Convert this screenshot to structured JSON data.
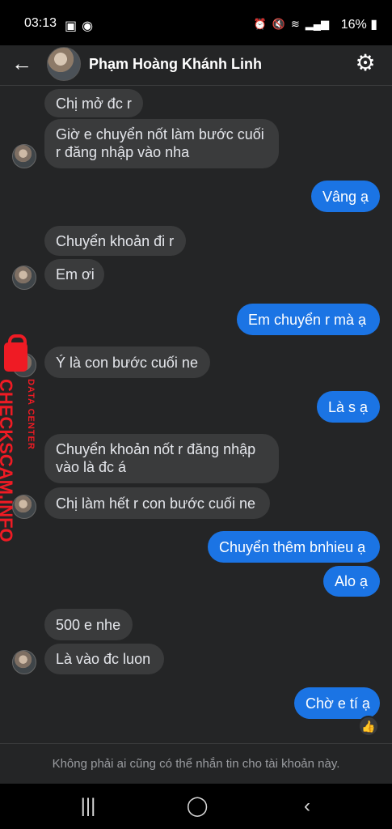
{
  "status_bar": {
    "time": "03:13",
    "battery": "16%",
    "left_icons": [
      "image-icon",
      "messenger-icon"
    ],
    "right_icons": [
      "alarm-icon",
      "mute-icon",
      "wifi-icon",
      "signal-icon",
      "battery-icon"
    ]
  },
  "header": {
    "contact_name": "Phạm Hoàng Khánh Linh",
    "back_icon": "arrow-left-icon",
    "settings_icon": "gear-icon"
  },
  "messages": [
    {
      "id": "m1",
      "direction": "in",
      "text": "Chị mở đc r"
    },
    {
      "id": "m2",
      "direction": "in",
      "text": "Giờ e chuyển nốt làm bước cuối r đăng nhập vào nha"
    },
    {
      "id": "m3",
      "direction": "out",
      "text": "Vâng ạ"
    },
    {
      "id": "m4",
      "direction": "in",
      "text": "Chuyển khoản đi r"
    },
    {
      "id": "m5",
      "direction": "in",
      "text": "Em ơi"
    },
    {
      "id": "m6",
      "direction": "out",
      "text": "Em chuyển r mà ạ"
    },
    {
      "id": "m7",
      "direction": "in",
      "text": "Ý là con bước cuối ne"
    },
    {
      "id": "m8",
      "direction": "out",
      "text": "Là s ạ"
    },
    {
      "id": "m9",
      "direction": "in",
      "text": "Chuyển khoản nốt r đăng nhập vào là đc á"
    },
    {
      "id": "m10",
      "direction": "in",
      "text": "Chị làm hết r con bước cuối ne"
    },
    {
      "id": "m11",
      "direction": "out",
      "text": "Chuyển thêm bnhieu ạ"
    },
    {
      "id": "m12",
      "direction": "out",
      "text": "Alo ạ"
    },
    {
      "id": "m13",
      "direction": "in",
      "text": "500 e nhe"
    },
    {
      "id": "m14",
      "direction": "in",
      "text": "Là vào đc luon"
    },
    {
      "id": "m15",
      "direction": "out",
      "text": "Chờ e tí ạ"
    }
  ],
  "reaction": {
    "emoji": "👍",
    "icon": "thumbs-up-icon"
  },
  "notice": "Không phải ai cũng có thể nhắn tin cho tài khoản này.",
  "nav_bar": {
    "recent_apps": "|||",
    "home": "◯",
    "back": "‹"
  },
  "watermark": {
    "main": "CHECKSCAM.INFO",
    "sub": "DATA CENTER"
  },
  "colors": {
    "background": "#242526",
    "incoming_bubble": "#3a3b3c",
    "outgoing_bubble": "#1b74e4",
    "watermark": "#ef1b24"
  }
}
